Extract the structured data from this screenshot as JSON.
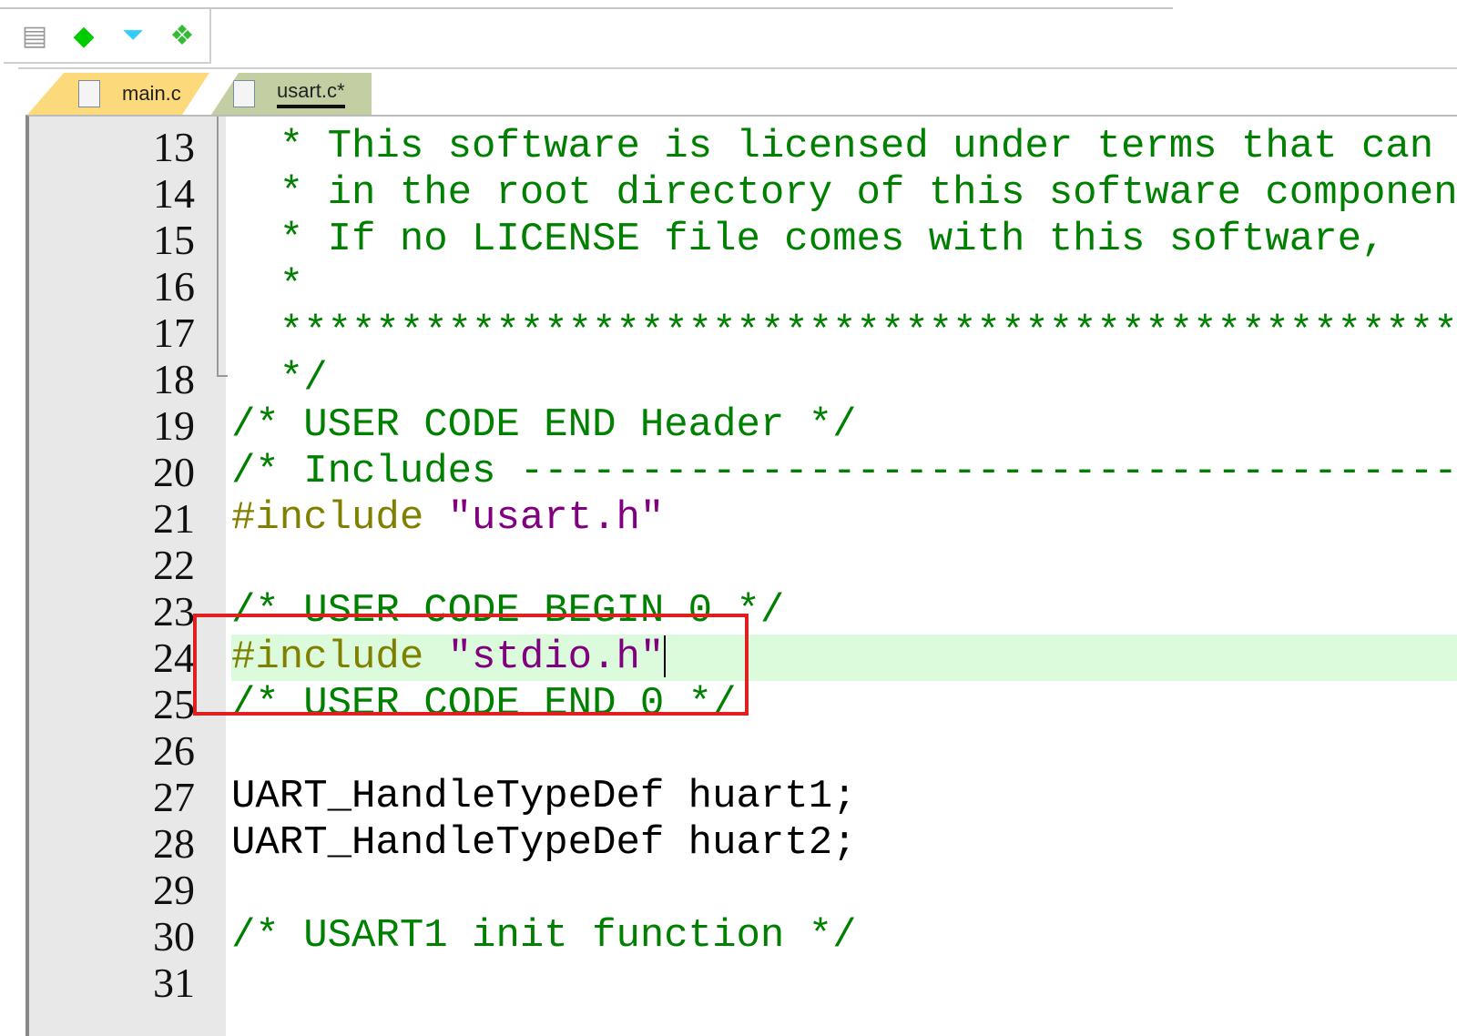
{
  "toolbar": {
    "icons": [
      "window-stack-icon",
      "green-diamond-icon",
      "filter-funnel-icon",
      "multi-diamond-icon"
    ]
  },
  "tabs": [
    {
      "label": "main.c",
      "color": "#fcd97a"
    },
    {
      "label": "usart.c*",
      "color": "#c3cfa3",
      "active": true
    }
  ],
  "lines": [
    {
      "n": "13",
      "t": "  * This software is licensed under terms that can",
      "cls": "c"
    },
    {
      "n": "14",
      "t": "  * in the root directory of this software component",
      "cls": "c"
    },
    {
      "n": "15",
      "t": "  * If no LICENSE file comes with this software,",
      "cls": "c"
    },
    {
      "n": "16",
      "t": "  *",
      "cls": "c"
    },
    {
      "n": "17",
      "t": "  ******************************************************",
      "cls": "c"
    },
    {
      "n": "18",
      "t": "  */",
      "cls": "c"
    },
    {
      "n": "19",
      "t": "/* USER CODE END Header */",
      "cls": "c"
    },
    {
      "n": "20",
      "t": "/* Includes ------------------------------------------",
      "cls": "c"
    },
    {
      "n": "21",
      "pre": "#include ",
      "str": "\"usart.h\""
    },
    {
      "n": "22",
      "t": ""
    },
    {
      "n": "23",
      "t": "/* USER CODE BEGIN 0 */",
      "cls": "c"
    },
    {
      "n": "24",
      "pre": "#include ",
      "str": "\"stdio.h\"",
      "current": true
    },
    {
      "n": "25",
      "t": "/* USER CODE END 0 */",
      "cls": "c"
    },
    {
      "n": "26",
      "t": ""
    },
    {
      "n": "27",
      "t": "UART_HandleTypeDef huart1;",
      "cls": "k"
    },
    {
      "n": "28",
      "t": "UART_HandleTypeDef huart2;",
      "cls": "k"
    },
    {
      "n": "29",
      "t": ""
    },
    {
      "n": "30",
      "t": "/* USART1 init function */",
      "cls": "c"
    },
    {
      "n": "31",
      "t": ""
    }
  ],
  "colors": {
    "comment": "#008000",
    "preprocessor": "#808000",
    "string": "#800080",
    "highlight": "#dcfadc",
    "annotation_box": "#e02020"
  }
}
